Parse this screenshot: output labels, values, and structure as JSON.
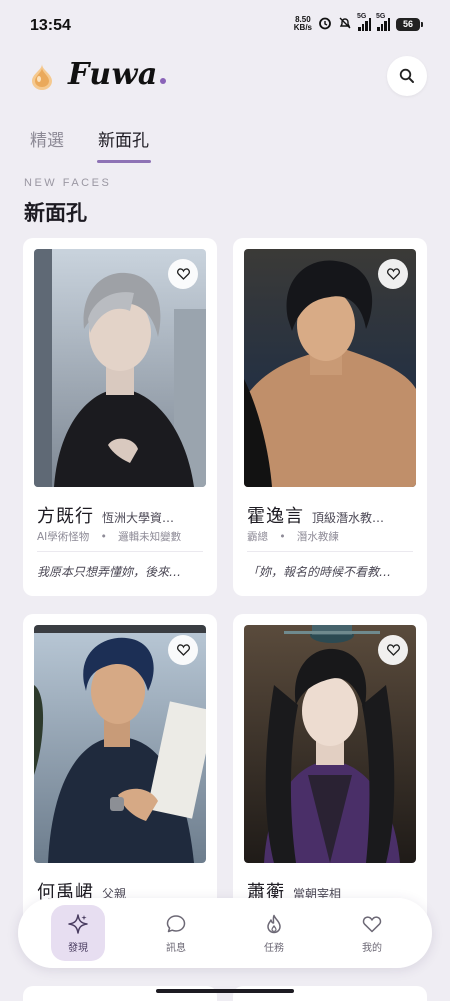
{
  "status_bar": {
    "time": "13:54",
    "net_speed_value": "8.50",
    "net_speed_unit": "KB/s",
    "signal1_label": "5G",
    "signal2_label": "5G",
    "battery": "56",
    "icons": [
      "alarm-icon",
      "mute-bell-icon",
      "signal-icon",
      "battery-icon"
    ]
  },
  "header": {
    "logo_text": "Fuwa",
    "search_icon": "search-icon"
  },
  "tabs": [
    {
      "label": "精選",
      "active": false
    },
    {
      "label": "新面孔",
      "active": true
    }
  ],
  "section": {
    "eyebrow": "NEW FACES",
    "title": "新面孔"
  },
  "cards": [
    {
      "name": "方既行",
      "role": "恆洲大學資…",
      "tag1": "AI學術怪物",
      "tag2": "邏輯未知變數",
      "quote": "我原本只想弄懂妳，後來…"
    },
    {
      "name": "霍逸言",
      "role": "頂級潛水教…",
      "tag1": "霸總",
      "tag2": "潛水教練",
      "quote": "「妳，報名的時候不看教…"
    },
    {
      "name": "何禹峮",
      "role": "父親"
    },
    {
      "name": "蕭蘅",
      "role": "當朝宰相"
    }
  ],
  "tag_separator": "•",
  "bottom_nav": [
    {
      "label": "發現",
      "icon": "sparkle-icon",
      "active": true
    },
    {
      "label": "訊息",
      "icon": "chat-bubble-icon",
      "active": false
    },
    {
      "label": "任務",
      "icon": "flame-icon",
      "active": false
    },
    {
      "label": "我的",
      "icon": "heart-icon",
      "active": false
    }
  ],
  "colors": {
    "background": "#efedf3",
    "accent": "#8e73b5",
    "active_nav_bg": "#e7def1"
  }
}
